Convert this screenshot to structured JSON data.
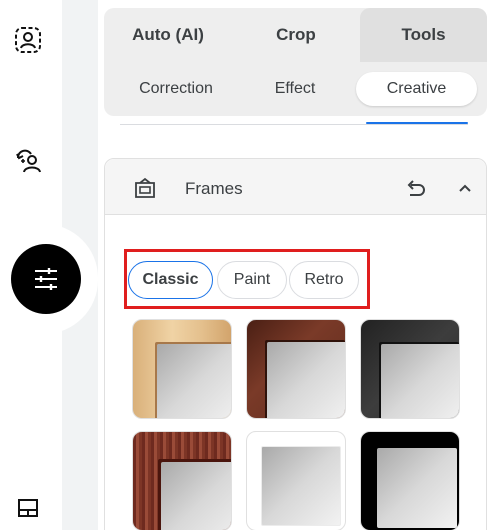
{
  "colors": {
    "accent": "#1a73e8",
    "highlight": "#e01e1e"
  },
  "rail": {
    "items": [
      {
        "name": "portrait-icon"
      },
      {
        "name": "retouch-person-icon"
      },
      {
        "name": "tune-sliders-icon"
      },
      {
        "name": "layout-icon"
      }
    ]
  },
  "tabs": {
    "main": [
      {
        "label": "Auto (AI)"
      },
      {
        "label": "Crop"
      },
      {
        "label": "Tools",
        "active": true
      }
    ],
    "sub": [
      {
        "label": "Correction"
      },
      {
        "label": "Effect"
      },
      {
        "label": "Creative",
        "active": true
      }
    ]
  },
  "frames": {
    "title": "Frames",
    "categories": [
      {
        "label": "Classic",
        "active": true
      },
      {
        "label": "Paint"
      },
      {
        "label": "Retro"
      }
    ],
    "thumbnails": [
      {
        "style": "light-wood"
      },
      {
        "style": "dark-wood"
      },
      {
        "style": "black-textured"
      },
      {
        "style": "carved-red-wood"
      },
      {
        "style": "thin-white"
      },
      {
        "style": "thick-black"
      }
    ]
  }
}
